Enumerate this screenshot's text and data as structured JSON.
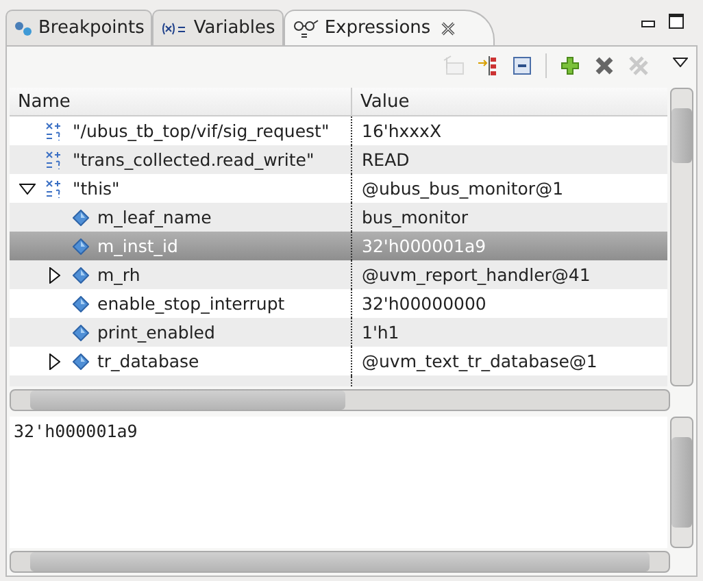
{
  "tabs": [
    {
      "label": "Breakpoints",
      "selected": false,
      "kind": "breakpoints"
    },
    {
      "label": "Variables",
      "selected": false,
      "kind": "variables"
    },
    {
      "label": "Expressions",
      "selected": true,
      "kind": "expressions"
    }
  ],
  "toolbar": [
    {
      "kind": "select-all",
      "disabled": true
    },
    {
      "kind": "expand",
      "disabled": false
    },
    {
      "kind": "collapse",
      "disabled": false
    },
    {
      "kind": "add",
      "disabled": false
    },
    {
      "kind": "remove",
      "disabled": false
    },
    {
      "kind": "remove-all",
      "disabled": true
    }
  ],
  "table": {
    "columns": [
      "Name",
      "Value"
    ],
    "rows": [
      {
        "kind": "expression",
        "name": "\"/ubus_tb_top/vif/sig_request\"",
        "value": "16'hxxxX",
        "selected": false
      },
      {
        "kind": "expression",
        "name": "\"trans_collected.read_write\"",
        "value": "READ",
        "selected": false
      },
      {
        "kind": "expression",
        "name": "\"this\"",
        "value": "@ubus_bus_monitor@1",
        "selected": false,
        "expanded": true,
        "children": [
          {
            "kind": "variable",
            "name": "m_leaf_name",
            "value": "bus_monitor",
            "selected": false
          },
          {
            "kind": "variable",
            "name": "m_inst_id",
            "value": "32'h000001a9",
            "selected": true
          },
          {
            "kind": "variable",
            "name": "m_rh",
            "value": "@uvm_report_handler@41",
            "selected": false,
            "expanded": false
          },
          {
            "kind": "variable",
            "name": "enable_stop_interrupt",
            "value": "32'h00000000",
            "selected": false
          },
          {
            "kind": "variable",
            "name": "print_enabled",
            "value": "1'h1",
            "selected": false
          },
          {
            "kind": "variable",
            "name": "tr_database",
            "value": "@uvm_text_tr_database@1",
            "selected": false,
            "expanded": false
          }
        ]
      }
    ]
  },
  "detail": {
    "value": "32'h000001a9"
  }
}
